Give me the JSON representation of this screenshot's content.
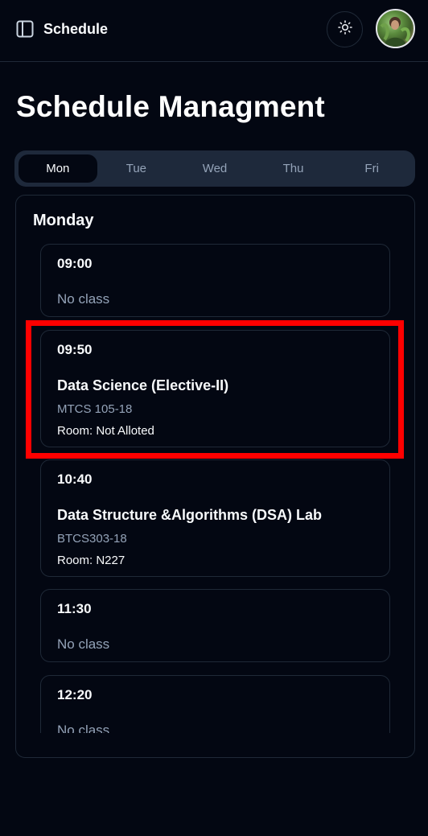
{
  "header": {
    "app_title": "Schedule",
    "sidebar_icon": "sidebar-panel-icon",
    "theme_icon": "sun-icon",
    "avatar_icon": "user-avatar"
  },
  "page": {
    "title": "Schedule Managment"
  },
  "tabs": [
    {
      "label": "Mon",
      "active": true
    },
    {
      "label": "Tue",
      "active": false
    },
    {
      "label": "Wed",
      "active": false
    },
    {
      "label": "Thu",
      "active": false
    },
    {
      "label": "Fri",
      "active": false
    }
  ],
  "day": {
    "title": "Monday",
    "slots": [
      {
        "time": "09:00",
        "no_class": "No class"
      },
      {
        "time": "09:50",
        "course": "Data Science (Elective-II)",
        "code": "MTCS 105-18",
        "room": "Room: Not Alloted"
      },
      {
        "time": "10:40",
        "course": "Data Structure &Algorithms (DSA) Lab",
        "code": "BTCS303-18",
        "room": "Room: N227"
      },
      {
        "time": "11:30",
        "no_class": "No class"
      },
      {
        "time": "12:20",
        "no_class": "No class"
      }
    ]
  },
  "colors": {
    "background": "#030712",
    "border": "#1f2937",
    "tab_bar": "#1e293b",
    "muted_text": "#94a3b8",
    "highlight": "#ff0000"
  }
}
